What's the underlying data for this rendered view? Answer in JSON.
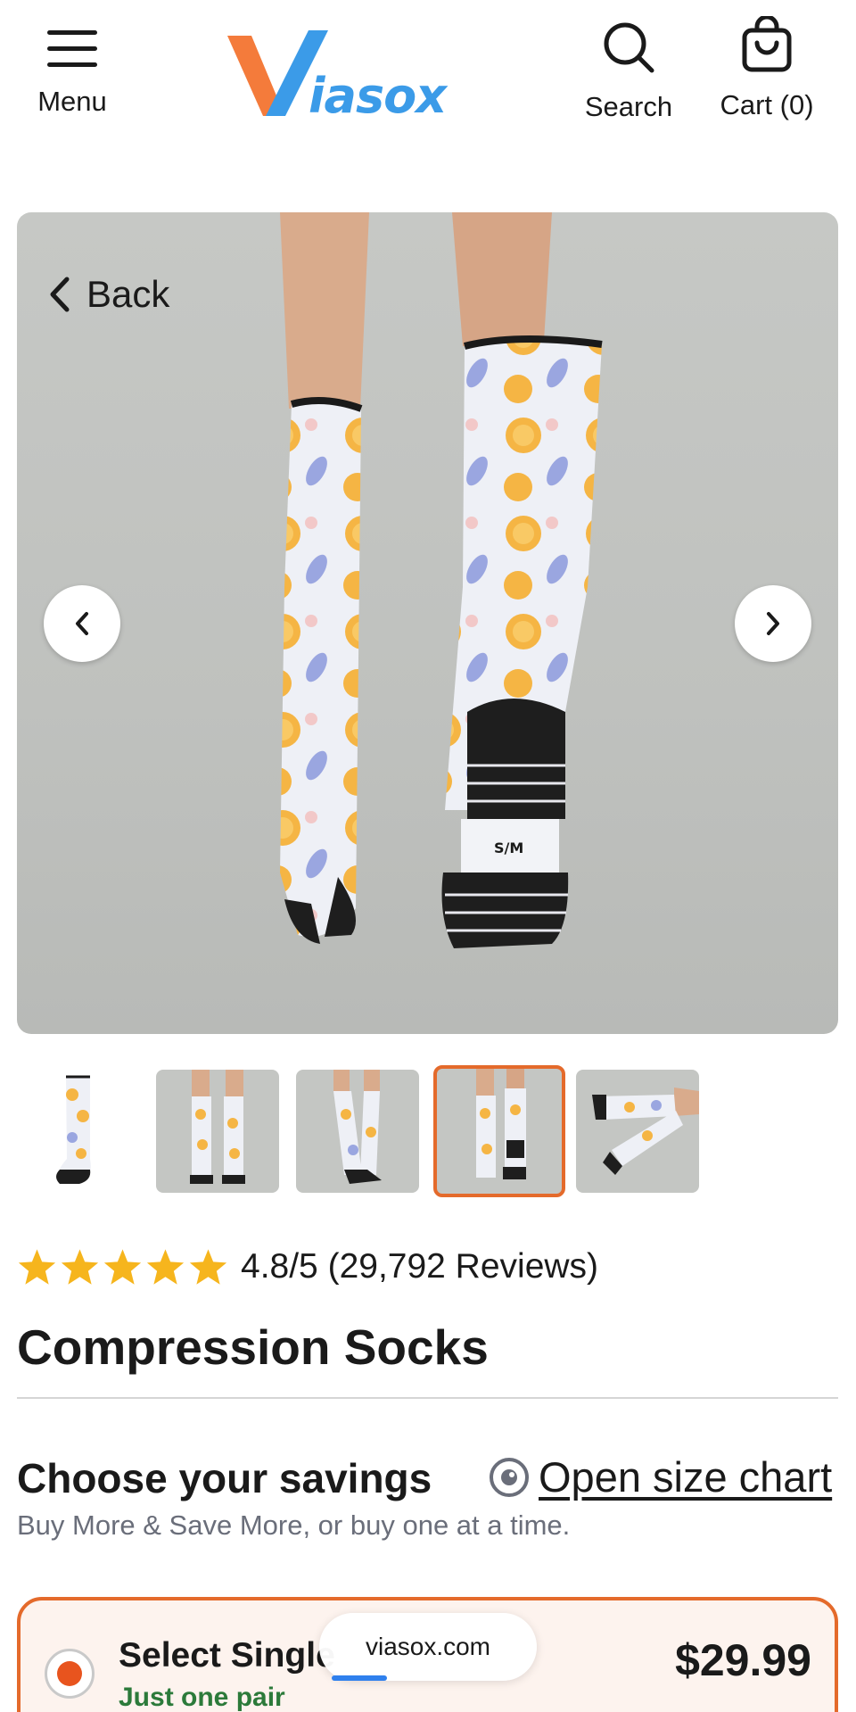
{
  "header": {
    "menu_label": "Menu",
    "logo_text": "Viasox",
    "search_label": "Search",
    "cart_label": "Cart (0)"
  },
  "hero": {
    "back_label": "Back",
    "image_alt": "Compression socks product photo (rear view)"
  },
  "thumbnails": [
    {
      "view": "single-sock",
      "active": false
    },
    {
      "view": "front-view",
      "active": false
    },
    {
      "view": "side-view",
      "active": false
    },
    {
      "view": "rear-view",
      "active": true
    },
    {
      "view": "leg-raised",
      "active": false
    }
  ],
  "product": {
    "rating_value": 4.8,
    "rating_max": 5,
    "rating_text": "4.8/5 (29,792 Reviews)",
    "title": "Compression Socks"
  },
  "savings": {
    "heading": "Choose your savings",
    "size_chart_label": "Open size chart",
    "subtext": "Buy More & Save More, or buy one at a time."
  },
  "option": {
    "title": "Select Single",
    "subtitle": "Just one pair",
    "price": "$29.99",
    "selected": true
  },
  "browser": {
    "url": "viasox.com"
  },
  "colors": {
    "accent": "#e46a2b",
    "logo_orange": "#f47b3b",
    "logo_blue": "#3b9be8",
    "star": "#f6b51d",
    "green": "#2c7a3a"
  }
}
